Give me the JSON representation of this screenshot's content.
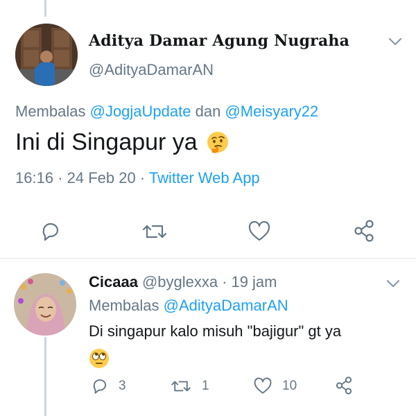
{
  "main_tweet": {
    "display_name": "Aditya Damar Agung Nugraha",
    "handle": "@AdityaDamarAN",
    "reply_prefix": "Membalas",
    "reply_to_1": "@JogjaUpdate",
    "reply_and": "dan",
    "reply_to_2": "@Meisyary22",
    "text": "Ini di Singapur ya",
    "emoji": "thinking-face",
    "time": "16:16",
    "date": "24 Feb 20",
    "sep": "·",
    "source": "Twitter Web App"
  },
  "reply_tweet": {
    "display_name": "Cicaaa",
    "handle": "@byglexxa",
    "sep": "·",
    "time_ago": "19 jam",
    "reply_prefix": "Membalas",
    "reply_to": "@AdityaDamarAN",
    "text": "Di singapur kalo misuh \"bajigur\" gt ya",
    "emoji": "face-with-rolling-eyes",
    "reply_count": "3",
    "retweet_count": "1",
    "like_count": "10"
  },
  "colors": {
    "link": "#1da1f2",
    "muted": "#657786",
    "text": "#14171a",
    "thread_line": "#c9d6e1",
    "divider": "#e1e8ed"
  },
  "icons": [
    "reply-icon",
    "retweet-icon",
    "like-icon",
    "share-icon",
    "chevron-down-icon"
  ]
}
